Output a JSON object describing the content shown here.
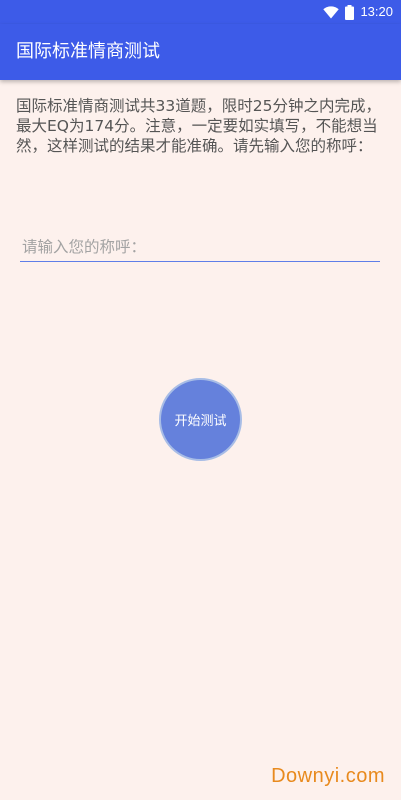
{
  "status_bar": {
    "time": "13:20",
    "icons": [
      "wifi-icon",
      "battery-icon"
    ],
    "background_color": "#3d5be8"
  },
  "app_bar": {
    "title": "国际标准情商测试",
    "background_color": "#3d5be8"
  },
  "main": {
    "intro_text": "国际标准情商测试共33道题，限时25分钟之内完成，最大EQ为174分。注意，一定要如实填写，不能想当然，这样测试的结果才能准确。请先输入您的称呼：",
    "name_input": {
      "value": "",
      "placeholder": "请输入您的称呼："
    },
    "start_button_label": "开始测试",
    "start_button_color": "#6581dc",
    "background_color": "#fdf1ed"
  },
  "watermark": {
    "text": "Downyi.com",
    "color": "#e88a1e"
  }
}
